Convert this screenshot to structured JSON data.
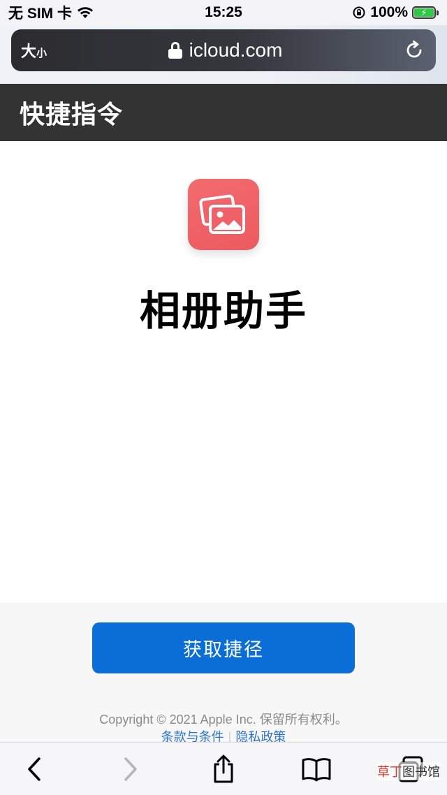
{
  "status_bar": {
    "carrier": "无 SIM 卡",
    "time": "15:25",
    "battery": "100%"
  },
  "browser": {
    "text_size_big": "大",
    "text_size_small": "小",
    "url": "icloud.com"
  },
  "header": {
    "title": "快捷指令"
  },
  "shortcut": {
    "name": "相册助手",
    "icon": "photos-icon",
    "icon_color": "#ef6166"
  },
  "actions": {
    "get_button_label": "获取捷径",
    "button_color": "#0a6ed6"
  },
  "footer": {
    "copyright": "Copyright © 2021 Apple Inc. 保留所有权利。",
    "terms_label": "条款与条件",
    "privacy_label": "隐私政策"
  },
  "toolbar": {
    "items": [
      "back-icon",
      "forward-icon",
      "share-icon",
      "bookmarks-icon",
      "tabs-icon"
    ]
  },
  "watermark": {
    "part1": "草丁",
    "part2": "图书馆"
  }
}
